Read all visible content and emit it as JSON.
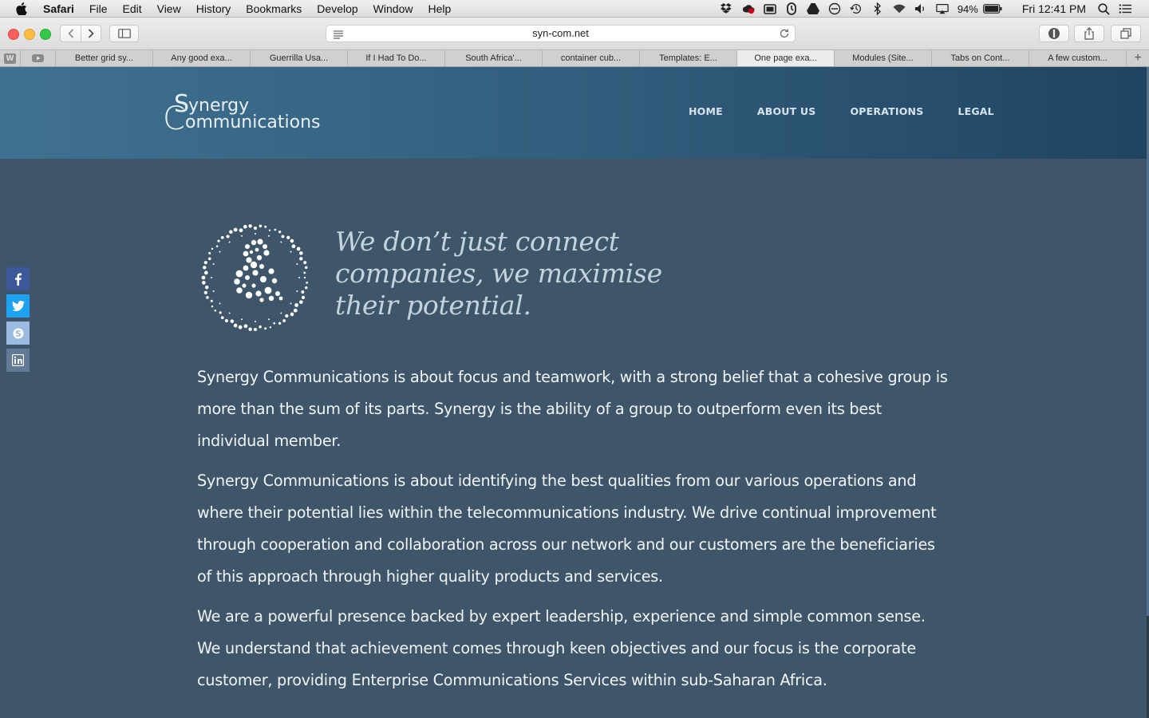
{
  "menubar": {
    "app_name": "Safari",
    "items": [
      "File",
      "Edit",
      "View",
      "History",
      "Bookmarks",
      "Develop",
      "Window",
      "Help"
    ],
    "battery": "94%",
    "clock": "Fri 12:41 PM"
  },
  "toolbar": {
    "url": "syn-com.net"
  },
  "tabs": {
    "pinned": [
      "W",
      "youtube"
    ],
    "items": [
      {
        "label": "Better grid sy..."
      },
      {
        "label": "Any good exa..."
      },
      {
        "label": "Guerrilla Usa..."
      },
      {
        "label": "If I Had To Do..."
      },
      {
        "label": "South Africa'..."
      },
      {
        "label": "container cub..."
      },
      {
        "label": "Templates: E..."
      },
      {
        "label": "One page exa...",
        "active": true
      },
      {
        "label": "Modules (Site..."
      },
      {
        "label": "Tabs on Cont..."
      },
      {
        "label": "A few custom..."
      }
    ],
    "add_label": "+"
  },
  "site": {
    "logo": {
      "line1": "ynergy",
      "line2": "ommunications",
      "initial1": "S",
      "initial2": "C"
    },
    "nav": [
      "HOME",
      "ABOUT US",
      "OPERATIONS",
      "LEGAL"
    ],
    "tagline": [
      "We don’t just connect",
      "companies, we maximise",
      "their potential."
    ],
    "paragraphs": [
      "Synergy Communications is about focus and teamwork, with a strong belief that a cohesive group is more than the sum of its parts. Synergy is the ability of a group to outperform even its best individual member.",
      "Synergy Communications is about identifying the best qualities from our various operations and where their potential lies within the telecommunications industry. We drive continual improvement through cooperation and collaboration across our network and our customers are the beneficiaries of this approach through higher quality products and services.",
      "We are a powerful presence backed by expert leadership, experience and simple common sense. We understand that achievement comes through keen objectives and our focus is the corporate customer, providing Enterprise Communications Services within sub-Saharan Africa."
    ],
    "social": [
      "facebook",
      "twitter",
      "skype",
      "linkedin"
    ],
    "colors": {
      "header_start": "#3f7190",
      "header_end": "#1f4461",
      "page_bg": "#3f5569",
      "text": "#f1f5f8"
    }
  }
}
